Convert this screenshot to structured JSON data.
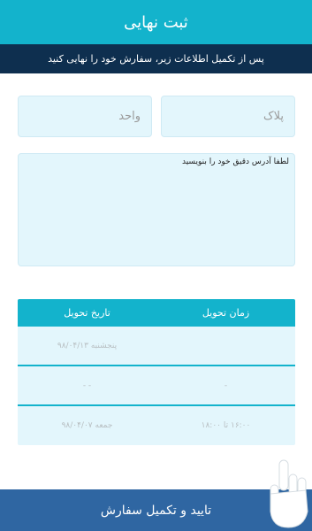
{
  "header": {
    "title": "ثبت نهایی"
  },
  "subheader": {
    "text": "پس از تکمیل اطلاعات زیر، سفارش خود را نهایی کنید"
  },
  "form": {
    "plate_placeholder": "پلاک",
    "unit_placeholder": "واحد",
    "address_placeholder": "لطفا آدرس دقیق خود را بنویسید"
  },
  "delivery_table": {
    "columns": [
      "زمان تحویل",
      "تاریخ تحویل"
    ],
    "rows": [
      {
        "time": "",
        "date": "پنجشنبه ۹۸/۰۴/۱۳"
      },
      {
        "time": "-",
        "date": "- -"
      },
      {
        "time": "۱۶:۰۰ تا ۱۸:۰۰",
        "date": "جمعه ۹۸/۰۴/۰۷"
      }
    ]
  },
  "footer": {
    "button_label": "تایید و تکمیل سفارش"
  },
  "colors": {
    "primary": "#13b3cc",
    "dark_bar": "#0e2f4f",
    "footer": "#2f66a2",
    "field_bg": "#e3f6fc"
  },
  "icons": {
    "overlay": "pointing-hand-icon"
  }
}
